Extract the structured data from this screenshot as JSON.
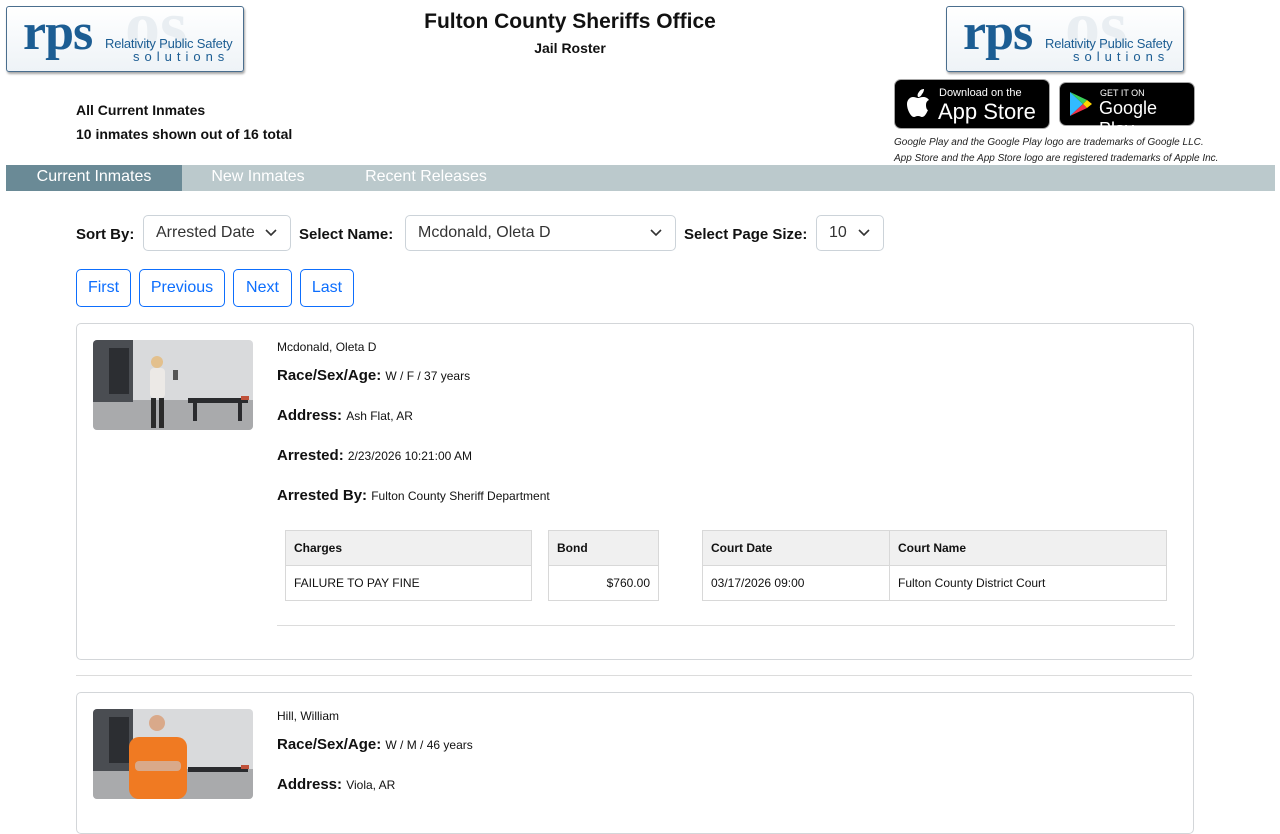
{
  "header": {
    "title": "Fulton County Sheriffs Office",
    "subtitle": "Jail Roster",
    "logo_left": {
      "mark": "rps",
      "line1": "Relativity Public Safety",
      "line2": "solutions"
    },
    "logo_right": {
      "mark": "rps",
      "line1": "Relativity Public Safety",
      "line2": "solutions"
    },
    "list_title": "All Current Inmates",
    "count_text": "10 inmates shown out of 16 total"
  },
  "stores": {
    "apple_small": "Download on the",
    "apple_big": "App Store",
    "google_small": "GET IT ON",
    "google_big": "Google Play",
    "legal1": "Google Play and the Google Play logo are trademarks of Google LLC.",
    "legal2": "App Store and the App Store logo are registered trademarks of Apple Inc."
  },
  "nav": {
    "tabs": [
      {
        "label": "Current Inmates",
        "active": true
      },
      {
        "label": "New Inmates",
        "active": false
      },
      {
        "label": "Recent Releases",
        "active": false
      }
    ]
  },
  "controls": {
    "sort_label": "Sort By:",
    "sort_value": "Arrested Date",
    "name_label": "Select Name:",
    "name_value": "Mcdonald, Oleta D",
    "pagesize_label": "Select Page Size:",
    "pagesize_value": "10"
  },
  "pager": {
    "first": "First",
    "previous": "Previous",
    "next": "Next",
    "last": "Last"
  },
  "labels": {
    "race": "Race/Sex/Age:",
    "address": "Address:",
    "arrested": "Arrested:",
    "arrested_by": "Arrested By:",
    "charges": "Charges",
    "bond": "Bond",
    "court_date": "Court Date",
    "court_name": "Court Name"
  },
  "inmates": [
    {
      "name": "Mcdonald, Oleta D",
      "race_sex_age": "W / F / 37 years",
      "address": "Ash Flat, AR",
      "arrested": "2/23/2026 10:21:00 AM",
      "arrested_by": "Fulton County Sheriff Department",
      "charge": "FAILURE TO PAY FINE",
      "bond": "$760.00",
      "court_date": "03/17/2026 09:00",
      "court_name": "Fulton County District Court"
    },
    {
      "name": "Hill, William",
      "race_sex_age": "W / M / 46 years",
      "address": "Viola, AR"
    }
  ],
  "colors": {
    "brand": "#1c5d93",
    "nav_bg": "#bbc9cc",
    "nav_active": "#6a8a96",
    "button_blue": "#0d6efd"
  }
}
